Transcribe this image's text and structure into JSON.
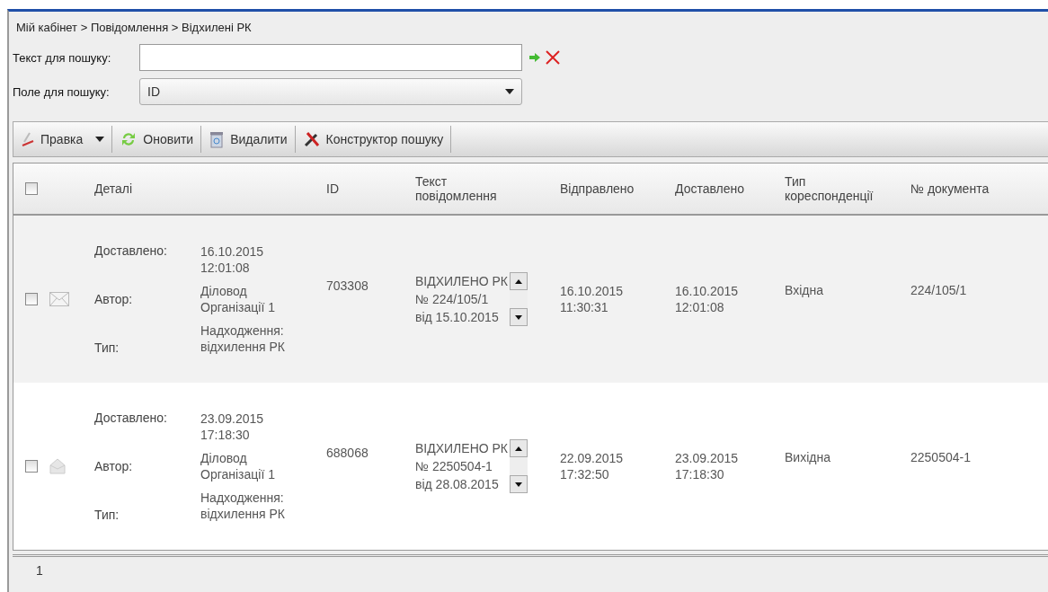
{
  "breadcrumb": "Мій кабінет > Повідомлення > Відхилені РК",
  "search": {
    "label": "Текст для пошуку:"
  },
  "search_field": {
    "label": "Поле для пошуку:",
    "value": "ID"
  },
  "toolbar": [
    {
      "label": "Правка",
      "kind": "edit"
    },
    {
      "label": "Оновити",
      "kind": "refresh"
    },
    {
      "label": "Видалити",
      "kind": "delete"
    },
    {
      "label": "Конструктор пошуку",
      "kind": "tools"
    }
  ],
  "table": {
    "all_checked": false,
    "columns": [
      "Деталі",
      "ID",
      "Текст повідомлення",
      "Відправлено",
      "Доставлено",
      "Тип кореспонденції",
      "№ документа"
    ],
    "rows": [
      {
        "selected": true,
        "checked": false,
        "read": false,
        "details": [
          {
            "label": "Доставлено:",
            "value": "16.10.2015 12:01:08"
          },
          {
            "label": "Автор:",
            "value": "Діловод Організації 1"
          },
          {
            "label": "Тип:",
            "value": "Надходження: відхилення РК"
          }
        ],
        "id": "703308",
        "text": [
          "ВІДХИЛЕНО РК",
          "№ 224/105/1",
          "від 15.10.2015"
        ],
        "sent": "16.10.2015 11:30:31",
        "delivered": "16.10.2015 12:01:08",
        "type": "Вхідна",
        "doc": "224/105/1"
      },
      {
        "selected": false,
        "checked": false,
        "read": true,
        "details": [
          {
            "label": "Доставлено:",
            "value": "23.09.2015 17:18:30"
          },
          {
            "label": "Автор:",
            "value": "Діловод Організації 1"
          },
          {
            "label": "Тип:",
            "value": "Надходження: відхилення РК"
          }
        ],
        "id": "688068",
        "text": [
          "ВІДХИЛЕНО РК",
          "№ 2250504-1",
          "від 28.08.2015"
        ],
        "sent": "22.09.2015 17:32:50",
        "delivered": "23.09.2015 17:18:30",
        "type": "Вихідна",
        "doc": "2250504-1"
      }
    ]
  },
  "pager": {
    "page": "1"
  }
}
